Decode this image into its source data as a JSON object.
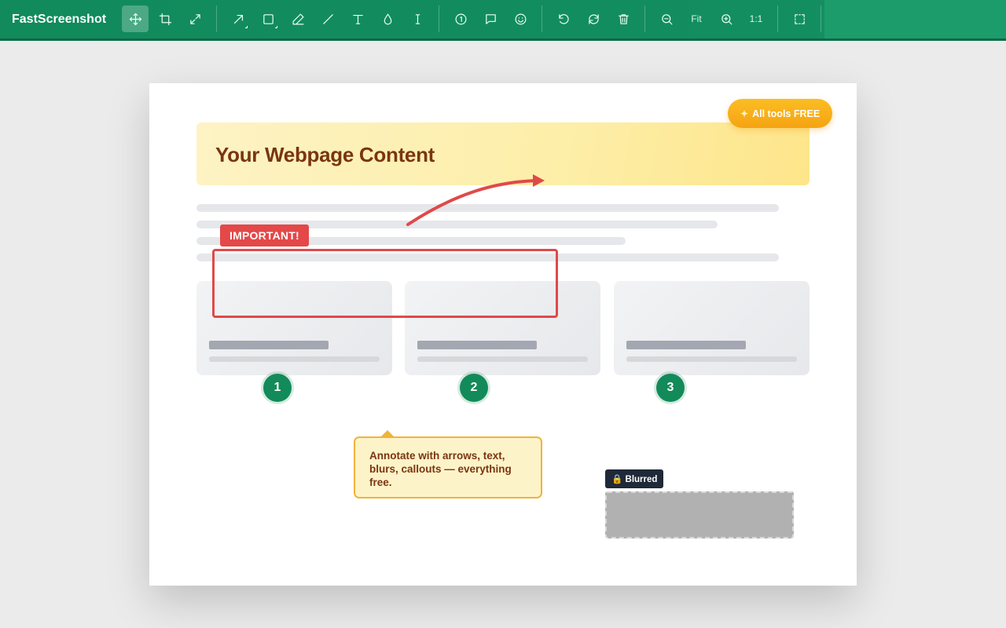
{
  "app": {
    "title": "FastScreenshot"
  },
  "toolbar": {
    "tools": [
      {
        "name": "move-icon",
        "active": true
      },
      {
        "name": "crop-icon"
      },
      {
        "name": "resize-icon"
      },
      {
        "name": "arrow-tool-icon"
      },
      {
        "name": "rectangle-tool-icon"
      },
      {
        "name": "pen-tool-icon"
      },
      {
        "name": "line-tool-icon"
      },
      {
        "name": "text-tool-icon"
      },
      {
        "name": "blur-tool-icon"
      },
      {
        "name": "cursor-text-icon"
      },
      {
        "name": "step-number-icon"
      },
      {
        "name": "callout-icon"
      },
      {
        "name": "emoji-icon"
      },
      {
        "name": "undo-icon"
      },
      {
        "name": "redo-icon"
      },
      {
        "name": "delete-icon"
      },
      {
        "name": "zoom-out-icon"
      },
      {
        "name": "zoom-in-icon"
      },
      {
        "name": "select-area-icon"
      }
    ],
    "fit_label": "Fit",
    "actual_size_label": "1:1"
  },
  "canvas": {
    "hero_title": "Your Webpage Content",
    "free_badge": "All tools FREE",
    "important_label": "IMPORTANT!",
    "steps": [
      "1",
      "2",
      "3"
    ],
    "callout_text": "Annotate with arrows, text, blurs, callouts — everything free.",
    "blur_label": "🔒 Blurred"
  },
  "colors": {
    "brand": "#138e61",
    "annotation_red": "#e0494a",
    "badge_orange": "#f5a312",
    "step_green": "#138a5a"
  }
}
